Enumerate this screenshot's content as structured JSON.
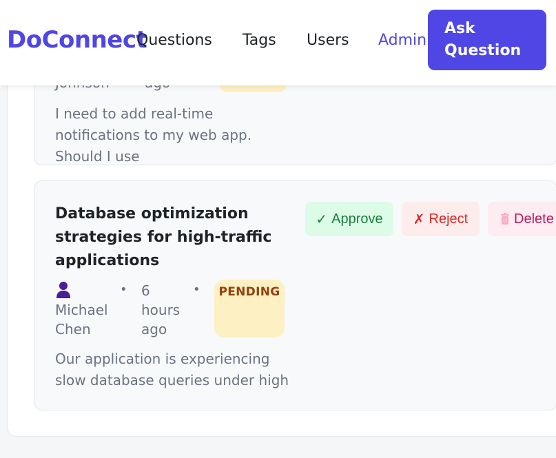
{
  "navbar": {
    "logo": "DoConnect",
    "links": [
      "Questions",
      "Tags",
      "Users",
      "Admin"
    ],
    "ask_button": "Ask Question"
  },
  "questions": [
    {
      "author_partial": "Johnson",
      "time_partial": "ago",
      "excerpt": "I need to add real-time notifications to my web app. Should I use"
    },
    {
      "title": "Database optimization strategies for high-traffic applications",
      "author": "Michael Chen",
      "time": "6 hours ago",
      "status": "PENDING",
      "excerpt": "Our application is experiencing slow database queries under high",
      "actions": {
        "approve": "Approve",
        "reject": "Reject",
        "delete": "Delete"
      }
    }
  ],
  "icons": {
    "approve": "✓",
    "reject": "✗"
  },
  "colors": {
    "brand": "#4f46e5",
    "pending_badge_bg": "#fdf0c2",
    "pending_badge_text": "#92400e",
    "approve": "#15803d",
    "reject": "#dc2626",
    "delete": "#be185d"
  }
}
